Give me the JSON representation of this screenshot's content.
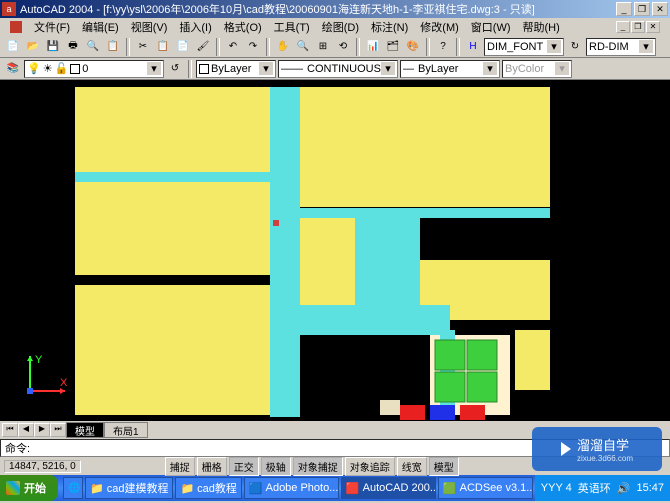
{
  "title": "AutoCAD 2004 - [f:\\yy\\ysl\\2006年\\2006年10月\\cad教程\\20060901海连新天地h-1-李亚祺住宅.dwg:3 - 只读]",
  "app_icon": "a",
  "menu": [
    "文件(F)",
    "编辑(E)",
    "视图(V)",
    "插入(I)",
    "格式(O)",
    "工具(T)",
    "绘图(D)",
    "标注(N)",
    "修改(M)",
    "窗口(W)",
    "帮助(H)"
  ],
  "toolbar2": {
    "dimstyle": "DIM_FONT",
    "rddim": "RD-DIM"
  },
  "layer_row": {
    "layer": "ByLayer",
    "linetype": "CONTINUOUS",
    "lineweight": "ByLayer",
    "color": "ByColor"
  },
  "tabs": {
    "model": "模型",
    "layout1": "布局1"
  },
  "cmd": "命令:",
  "status": {
    "coords": "14847, 5216, 0",
    "toggles": [
      "捕捉",
      "栅格",
      "正交",
      "极轴",
      "对象捕捉",
      "对象追踪",
      "线宽",
      "模型"
    ]
  },
  "taskbar": {
    "start": "开始",
    "items": [
      "cad建模教程",
      "cad教程",
      "Adobe Photo...",
      "AutoCAD 200...",
      "ACDSee v3.1..."
    ],
    "tray_text": "YYY 4",
    "tray_extra": "英语环",
    "clock": "15:47"
  },
  "watermark": {
    "brand": "溜溜自学",
    "url": "zixue.3d66.com"
  }
}
